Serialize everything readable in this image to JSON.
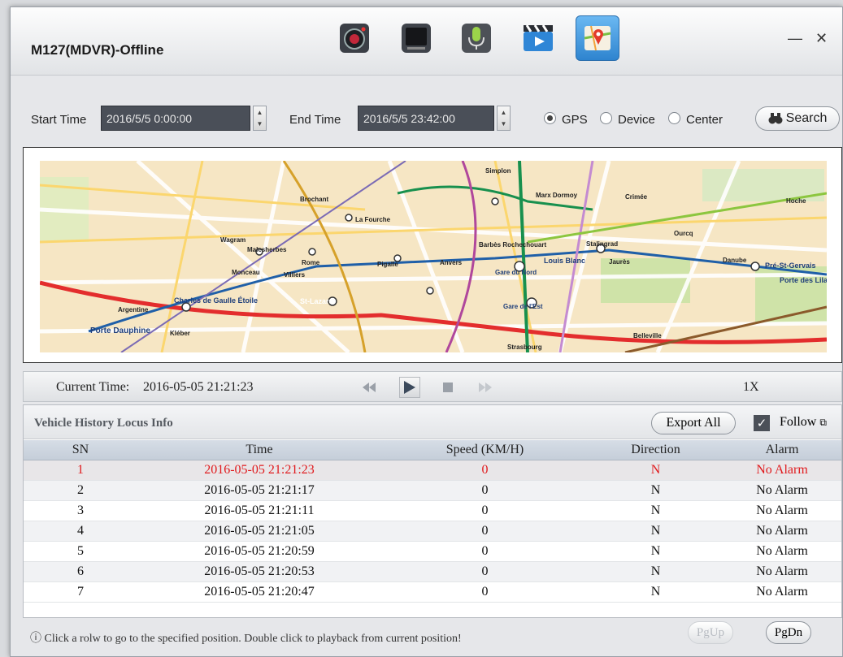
{
  "window": {
    "title": "M127(MDVR)-Offline",
    "toolbar": [
      {
        "name": "camera-snapshot-icon",
        "active": false
      },
      {
        "name": "monitor-icon",
        "active": false
      },
      {
        "name": "microphone-icon",
        "active": false
      },
      {
        "name": "video-clapper-icon",
        "active": false
      },
      {
        "name": "map-track-icon",
        "active": true
      }
    ],
    "minimize": "—",
    "close": "✕"
  },
  "query": {
    "start_label": "Start Time",
    "start_value": "2016/5/5 0:00:00",
    "end_label": "End Time",
    "end_value": "2016/5/5 23:42:00",
    "sources": [
      {
        "label": "GPS",
        "selected": true
      },
      {
        "label": "Device",
        "selected": false
      },
      {
        "label": "Center",
        "selected": false
      }
    ],
    "search_label": "Search"
  },
  "map": {
    "labels": {
      "coule_label_1": "Porte Dauphine",
      "coule_label_2": "Charles de Gaulle Étoile",
      "coule_label_3": "St-Lazare",
      "coule_label_4": "Louis Blanc",
      "coule_label_5": "Pré-St-Gervais",
      "coule_label_6": "Porte des Lilas",
      "coule_label_7": "Gare du Nord",
      "coule_label_8": "Gare de l'Est",
      "coule_label_9": "Stalingrad",
      "coule_label_10": "Pigalle",
      "coule_label_11": "Rome",
      "coule_label_12": "Wagram",
      "coule_label_13": "Malesherbes",
      "coule_label_14": "Villiers",
      "coule_label_15": "Monceau",
      "coule_label_16": "Marx Dormoy",
      "coule_label_17": "Crimée",
      "coule_label_18": "Jaurès",
      "coule_label_19": "Belleville",
      "coule_label_20": "Strasbourg",
      "coule_label_21": "Argentine",
      "coule_label_22": "Kléber",
      "coule_label_23": "Anvers",
      "coule_label_24": "Barbès Rochechouart",
      "coule_label_25": "Simplon",
      "coule_label_26": "Brochant",
      "coule_label_27": "La Fourche",
      "coule_label_28": "Hoche",
      "coule_label_29": "Ourcq",
      "coule_label_30": "Danube"
    }
  },
  "playback": {
    "current_time_label": "Current Time:",
    "current_time": "2016-05-05 21:21:23",
    "speed": "1X"
  },
  "locus": {
    "title": "Vehicle History Locus Info",
    "export_label": "Export All",
    "follow_label": "Follow",
    "follow_checked": true,
    "columns": [
      "SN",
      "Time",
      "Speed (KM/H)",
      "Direction",
      "Alarm"
    ],
    "rows": [
      {
        "sn": "1",
        "time": "2016-05-05 21:21:23",
        "speed": "0",
        "dir": "N",
        "alarm": "No Alarm"
      },
      {
        "sn": "2",
        "time": "2016-05-05 21:21:17",
        "speed": "0",
        "dir": "N",
        "alarm": "No Alarm"
      },
      {
        "sn": "3",
        "time": "2016-05-05 21:21:11",
        "speed": "0",
        "dir": "N",
        "alarm": "No Alarm"
      },
      {
        "sn": "4",
        "time": "2016-05-05 21:21:05",
        "speed": "0",
        "dir": "N",
        "alarm": "No Alarm"
      },
      {
        "sn": "5",
        "time": "2016-05-05 21:20:59",
        "speed": "0",
        "dir": "N",
        "alarm": "No Alarm"
      },
      {
        "sn": "6",
        "time": "2016-05-05 21:20:53",
        "speed": "0",
        "dir": "N",
        "alarm": "No Alarm"
      },
      {
        "sn": "7",
        "time": "2016-05-05 21:20:47",
        "speed": "0",
        "dir": "N",
        "alarm": "No Alarm"
      }
    ]
  },
  "footer": {
    "hint": "Click a rolw to go to the specified position. Double click to playback from current position!",
    "pgup": "PgUp",
    "pgdn": "PgDn"
  },
  "colors": {
    "accent": "#2e84cf",
    "alarm_red": "#e0191c",
    "field_bg": "#4a4f58"
  }
}
